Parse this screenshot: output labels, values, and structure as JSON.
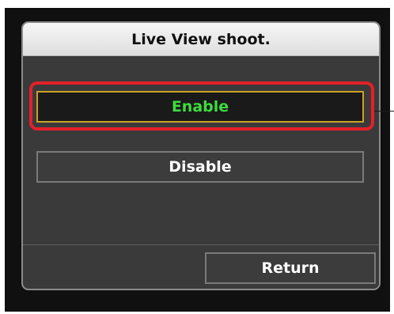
{
  "dialog": {
    "title": "Live View shoot."
  },
  "options": {
    "enable_label": "Enable",
    "disable_label": "Disable",
    "selected": "Enable"
  },
  "footer": {
    "return_label": "Return"
  },
  "colors": {
    "selected_text": "#3ddc3d",
    "selected_border": "#c9a227",
    "highlight_ring": "#e4202a",
    "dialog_bg": "#3a3a3a"
  }
}
